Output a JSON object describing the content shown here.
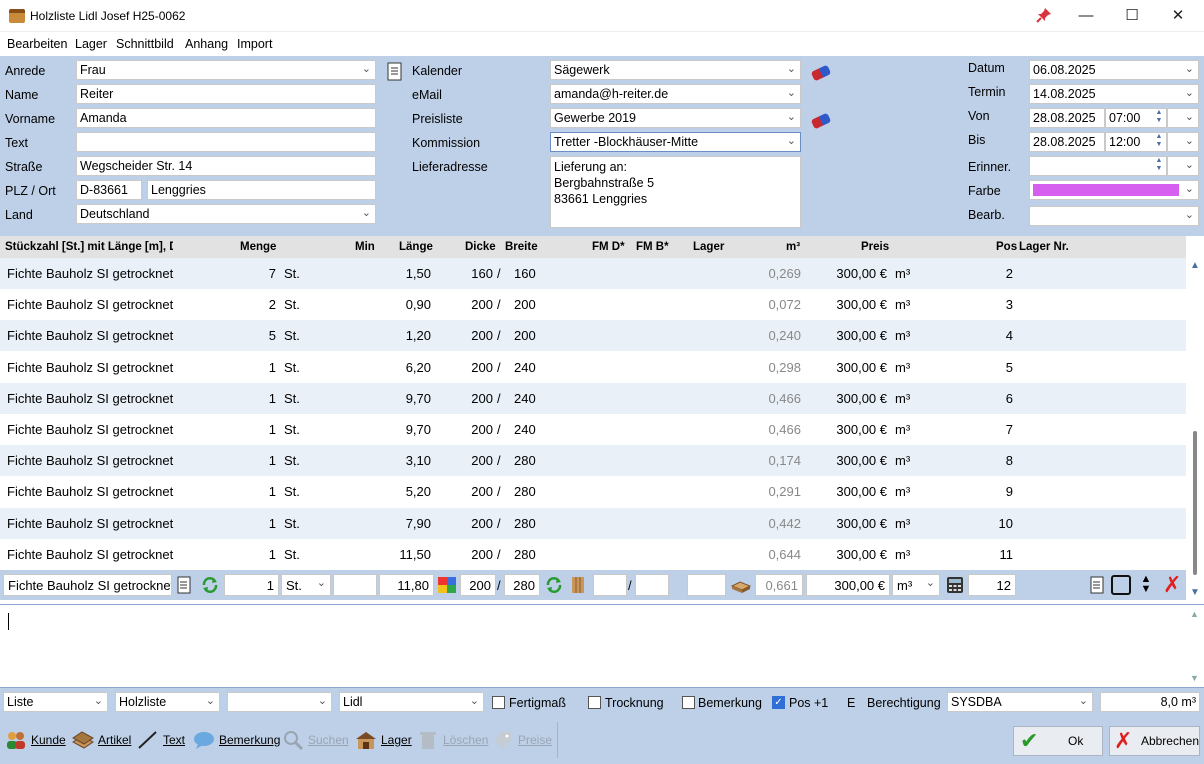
{
  "window": {
    "title": "Holzliste Lidl Josef H25-0062",
    "pin_icon": "pin-icon",
    "min_glyph": "—",
    "max_glyph": "☐",
    "close_glyph": "✕"
  },
  "menu": [
    "Bearbeiten",
    "Lager",
    "Schnittbild",
    "Anhang",
    "Import"
  ],
  "customer": {
    "anrede_label": "Anrede",
    "anrede": "Frau",
    "name_label": "Name",
    "name": "Reiter",
    "vorname_label": "Vorname",
    "vorname": "Amanda",
    "text_label": "Text",
    "text": "",
    "strasse_label": "Straße",
    "strasse": "Wegscheider Str. 14",
    "plzort_label": "PLZ / Ort",
    "plz": "D-83661",
    "ort": "Lenggries",
    "land_label": "Land",
    "land": "Deutschland"
  },
  "middle": {
    "kalender_label": "Kalender",
    "kalender": "Sägewerk",
    "email_label": "eMail",
    "email": "amanda@h-reiter.de",
    "preisliste_label": "Preisliste",
    "preisliste": "Gewerbe 2019",
    "kommission_label": "Kommission",
    "kommission": "Tretter -Blockhäuser-Mitte",
    "lieferadresse_label": "Lieferadresse",
    "lieferadresse": [
      "Lieferung an:",
      "Bergbahnstraße 5",
      "83661 Lenggries"
    ]
  },
  "dates": {
    "datum_label": "Datum",
    "datum": "06.08.2025",
    "termin_label": "Termin",
    "termin": "14.08.2025",
    "von_label": "Von",
    "von_date": "28.08.2025",
    "von_time": "07:00",
    "bis_label": "Bis",
    "bis_date": "28.08.2025",
    "bis_time": "12:00",
    "erinner_label": "Erinner.",
    "farbe_label": "Farbe",
    "farbe_color": "#d65ff0",
    "bearb_label": "Bearb."
  },
  "table": {
    "headers": {
      "desc": "Stückzahl [St.] mit Länge [m], D",
      "menge": "Menge",
      "min": "Min",
      "laenge": "Länge",
      "dicke": "Dicke",
      "breite": "Breite",
      "fmd": "FM D*",
      "fmb": "FM B*",
      "lager": "Lager",
      "m3": "m³",
      "preis": "Preis",
      "pos": "Pos",
      "lagernr": "Lager Nr."
    },
    "rows": [
      {
        "desc": "Fichte Bauholz SI getrocknet",
        "menge": "7",
        "unit": "St.",
        "laenge": "1,50",
        "dicke": "160",
        "breite": "160",
        "m3": "0,269",
        "preis": "300,00 €",
        "punit": "m³",
        "pos": "2"
      },
      {
        "desc": "Fichte Bauholz SI getrocknet",
        "menge": "2",
        "unit": "St.",
        "laenge": "0,90",
        "dicke": "200",
        "breite": "200",
        "m3": "0,072",
        "preis": "300,00 €",
        "punit": "m³",
        "pos": "3"
      },
      {
        "desc": "Fichte Bauholz SI getrocknet",
        "menge": "5",
        "unit": "St.",
        "laenge": "1,20",
        "dicke": "200",
        "breite": "200",
        "m3": "0,240",
        "preis": "300,00 €",
        "punit": "m³",
        "pos": "4"
      },
      {
        "desc": "Fichte Bauholz SI getrocknet",
        "menge": "1",
        "unit": "St.",
        "laenge": "6,20",
        "dicke": "200",
        "breite": "240",
        "m3": "0,298",
        "preis": "300,00 €",
        "punit": "m³",
        "pos": "5"
      },
      {
        "desc": "Fichte Bauholz SI getrocknet",
        "menge": "1",
        "unit": "St.",
        "laenge": "9,70",
        "dicke": "200",
        "breite": "240",
        "m3": "0,466",
        "preis": "300,00 €",
        "punit": "m³",
        "pos": "6"
      },
      {
        "desc": "Fichte Bauholz SI getrocknet",
        "menge": "1",
        "unit": "St.",
        "laenge": "9,70",
        "dicke": "200",
        "breite": "240",
        "m3": "0,466",
        "preis": "300,00 €",
        "punit": "m³",
        "pos": "7"
      },
      {
        "desc": "Fichte Bauholz SI getrocknet",
        "menge": "1",
        "unit": "St.",
        "laenge": "3,10",
        "dicke": "200",
        "breite": "280",
        "m3": "0,174",
        "preis": "300,00 €",
        "punit": "m³",
        "pos": "8"
      },
      {
        "desc": "Fichte Bauholz SI getrocknet",
        "menge": "1",
        "unit": "St.",
        "laenge": "5,20",
        "dicke": "200",
        "breite": "280",
        "m3": "0,291",
        "preis": "300,00 €",
        "punit": "m³",
        "pos": "9"
      },
      {
        "desc": "Fichte Bauholz SI getrocknet",
        "menge": "1",
        "unit": "St.",
        "laenge": "7,90",
        "dicke": "200",
        "breite": "280",
        "m3": "0,442",
        "preis": "300,00 €",
        "punit": "m³",
        "pos": "10"
      },
      {
        "desc": "Fichte Bauholz SI getrocknet",
        "menge": "1",
        "unit": "St.",
        "laenge": "11,50",
        "dicke": "200",
        "breite": "280",
        "m3": "0,644",
        "preis": "300,00 €",
        "punit": "m³",
        "pos": "11"
      }
    ]
  },
  "edit": {
    "desc": "Fichte Bauholz SI getrocknet",
    "menge": "1",
    "unit": "St.",
    "min": "",
    "laenge": "11,80",
    "dicke": "200",
    "slash1": "/",
    "breite": "280",
    "fmd": "",
    "slash2": "/",
    "fmb": "",
    "lager": "",
    "m3": "0,661",
    "preis": "300,00 €",
    "punit": "m³",
    "pos": "12"
  },
  "options": {
    "liste": "Liste",
    "holzliste": "Holzliste",
    "empty": "",
    "lidl": "Lidl",
    "fertigmass": "Fertigmaß",
    "trocknung": "Trocknung",
    "bemerkung": "Bemerkung",
    "pos1": "Pos +1",
    "pos1_checked": true,
    "b_trunc": "E",
    "berechtigung_label": "Berechtigung",
    "berechtigung": "SYSDBA",
    "total": "8,0 m³"
  },
  "toolbar": {
    "kunde": "Kunde",
    "artikel": "Artikel",
    "text": "Text",
    "bemerkung": "Bemerkung",
    "suchen": "Suchen",
    "lager": "Lager",
    "loeschen": "Löschen",
    "preise": "Preise",
    "ok": "Ok",
    "abbrechen": "Abbrechen"
  }
}
